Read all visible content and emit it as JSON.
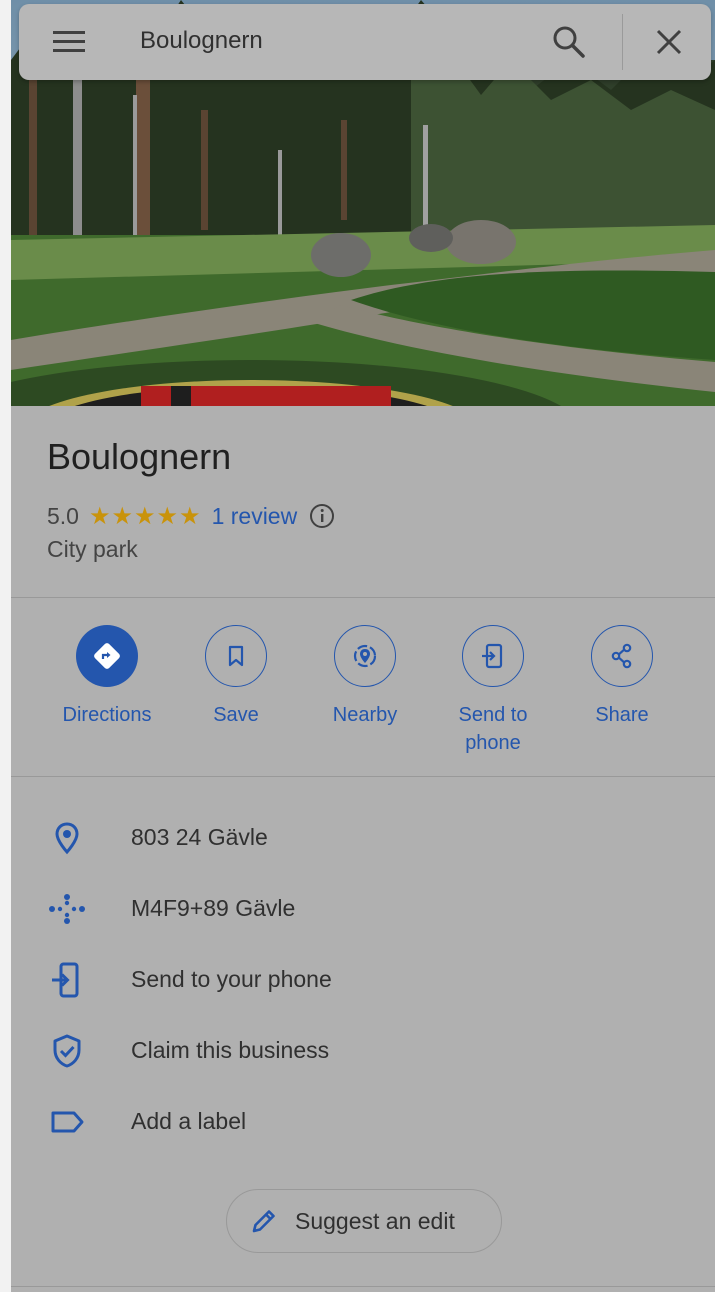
{
  "search": {
    "query": "Boulognern"
  },
  "place": {
    "name": "Boulognern",
    "rating": "5.0",
    "stars": "★★★★★",
    "reviews": "1 review",
    "category": "City park"
  },
  "actions": [
    {
      "label": "Directions",
      "icon": "directions-icon"
    },
    {
      "label": "Save",
      "icon": "bookmark-icon"
    },
    {
      "label": "Nearby",
      "icon": "nearby-icon"
    },
    {
      "label": "Send to phone",
      "icon": "send-to-phone-icon"
    },
    {
      "label": "Share",
      "icon": "share-icon"
    }
  ],
  "info": [
    {
      "text": "803 24 Gävle",
      "icon": "location-pin-icon"
    },
    {
      "text": "M4F9+89 Gävle",
      "icon": "plus-code-icon"
    },
    {
      "text": "Send to your phone",
      "icon": "send-to-phone-icon"
    },
    {
      "text": "Claim this business",
      "icon": "shield-check-icon"
    },
    {
      "text": "Add a label",
      "icon": "label-icon"
    }
  ],
  "suggest_edit": "Suggest an edit",
  "colors": {
    "accent": "#2456ad",
    "star": "#c9930b",
    "background": "#b0b0b0"
  }
}
